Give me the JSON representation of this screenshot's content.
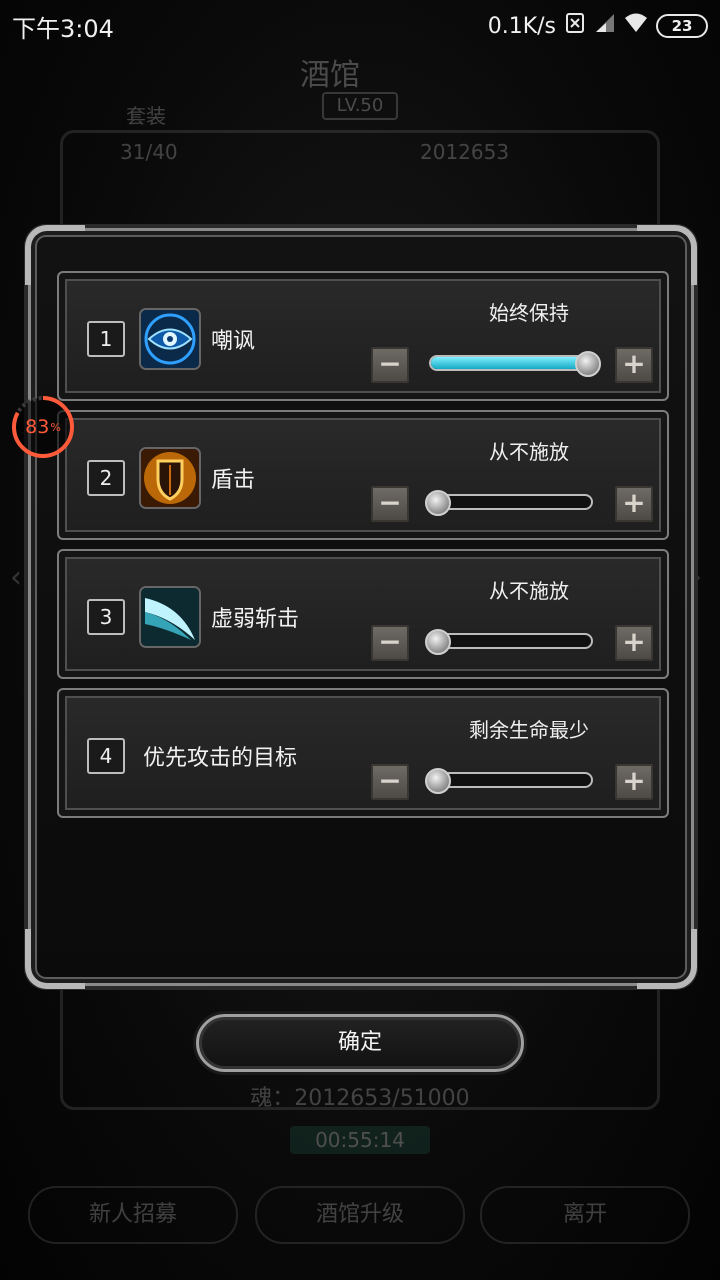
{
  "status_bar": {
    "time": "下午3:04",
    "net_speed": "0.1K/s",
    "battery": "23"
  },
  "background": {
    "title": "酒馆",
    "level": "LV.50",
    "set_label": "套装",
    "count": "31/40",
    "soul_top": "2012653",
    "soul": "魂：2012653/51000",
    "timer": "00:55:14",
    "buttons": [
      "新人招募",
      "酒馆升级",
      "离开"
    ]
  },
  "progress_ring": {
    "value": "83",
    "unit": "%",
    "fraction": 0.83
  },
  "dialog": {
    "rows": [
      {
        "index": "1",
        "name": "嘲讽",
        "setting": "始终保持",
        "level": 1.0,
        "icon": "eye-icon"
      },
      {
        "index": "2",
        "name": "盾击",
        "setting": "从不施放",
        "level": 0.0,
        "icon": "shield-icon"
      },
      {
        "index": "3",
        "name": "虚弱斩击",
        "setting": "从不施放",
        "level": 0.0,
        "icon": "slash-icon"
      },
      {
        "index": "4",
        "name": "优先攻击的目标",
        "setting": "剩余生命最少",
        "level": 0.0,
        "icon": ""
      }
    ],
    "minus": "−",
    "plus": "+",
    "confirm": "确定"
  },
  "colors": {
    "accent": "#16a9c4",
    "ring": "#ff5a3a"
  }
}
